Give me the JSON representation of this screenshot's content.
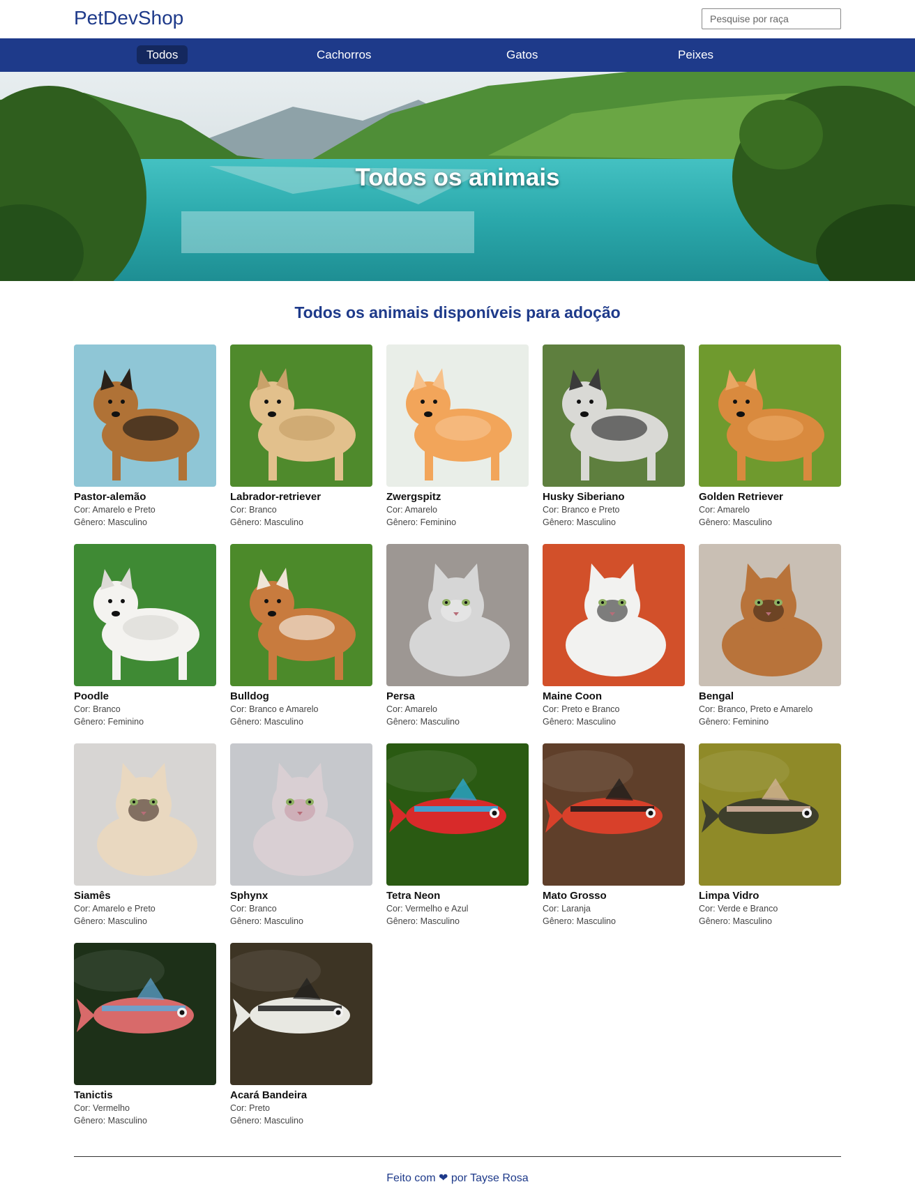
{
  "header": {
    "brand": "PetDevShop",
    "search_placeholder": "Pesquise por raça"
  },
  "nav": {
    "tabs": [
      {
        "label": "Todos",
        "active": true
      },
      {
        "label": "Cachorros",
        "active": false
      },
      {
        "label": "Gatos",
        "active": false
      },
      {
        "label": "Peixes",
        "active": false
      }
    ]
  },
  "hero": {
    "title": "Todos os animais"
  },
  "section": {
    "title": "Todos os animais disponíveis para adoção",
    "color_label": "Cor:",
    "gender_label": "Gênero:"
  },
  "animals": [
    {
      "name": "Pastor-alemão",
      "color": "Amarelo e Preto",
      "gender": "Masculino",
      "kind": "dog",
      "bg": "#8fc6d6",
      "body": "#b07236",
      "accent": "#2a2119"
    },
    {
      "name": "Labrador-retriever",
      "color": "Branco",
      "gender": "Masculino",
      "kind": "dog",
      "bg": "#4f8a2c",
      "body": "#e2c08c",
      "accent": "#c9a26a"
    },
    {
      "name": "Zwergspitz",
      "color": "Amarelo",
      "gender": "Feminino",
      "kind": "dog",
      "bg": "#e9eee8",
      "body": "#f2a55a",
      "accent": "#f7c18a"
    },
    {
      "name": "Husky Siberiano",
      "color": "Branco e Preto",
      "gender": "Masculino",
      "kind": "dog",
      "bg": "#5e7f3e",
      "body": "#d9d9d5",
      "accent": "#3b3b3b"
    },
    {
      "name": "Golden Retriever",
      "color": "Amarelo",
      "gender": "Masculino",
      "kind": "dog",
      "bg": "#6f9a2e",
      "body": "#d98a3e",
      "accent": "#e9a763"
    },
    {
      "name": "Poodle",
      "color": "Branco",
      "gender": "Feminino",
      "kind": "dog",
      "bg": "#3f8a34",
      "body": "#f4f3f0",
      "accent": "#dcdad6"
    },
    {
      "name": "Bulldog",
      "color": "Branco e Amarelo",
      "gender": "Masculino",
      "kind": "dog",
      "bg": "#4c8a2a",
      "body": "#c87b3e",
      "accent": "#efe4d6"
    },
    {
      "name": "Persa",
      "color": "Amarelo",
      "gender": "Masculino",
      "kind": "cat",
      "bg": "#9d9793",
      "body": "#d6d6d6",
      "accent": "#ededed"
    },
    {
      "name": "Maine Coon",
      "color": "Preto e Branco",
      "gender": "Masculino",
      "kind": "cat",
      "bg": "#d2502a",
      "body": "#f2f2f0",
      "accent": "#2e2e2e"
    },
    {
      "name": "Bengal",
      "color": "Branco, Preto e Amarelo",
      "gender": "Feminino",
      "kind": "cat",
      "bg": "#c9bfb4",
      "body": "#b8733a",
      "accent": "#3a2516"
    },
    {
      "name": "Siamês",
      "color": "Amarelo e Preto",
      "gender": "Masculino",
      "kind": "cat",
      "bg": "#d7d5d3",
      "body": "#e9d8c0",
      "accent": "#3e2a22"
    },
    {
      "name": "Sphynx",
      "color": "Branco",
      "gender": "Masculino",
      "kind": "cat",
      "bg": "#c6c8cc",
      "body": "#d9cfd3",
      "accent": "#c79aa6"
    },
    {
      "name": "Tetra Neon",
      "color": "Vermelho e Azul",
      "gender": "Masculino",
      "kind": "fish",
      "bg": "#2a5a12",
      "body": "#d82a2a",
      "accent": "#2ab0e8"
    },
    {
      "name": "Mato Grosso",
      "color": "Laranja",
      "gender": "Masculino",
      "kind": "fish",
      "bg": "#5f3f2a",
      "body": "#d8402a",
      "accent": "#1a1a1a"
    },
    {
      "name": "Limpa Vidro",
      "color": "Verde e Branco",
      "gender": "Masculino",
      "kind": "fish",
      "bg": "#8f8a28",
      "body": "#3e3f2c",
      "accent": "#d9b6a2"
    },
    {
      "name": "Tanictis",
      "color": "Vermelho",
      "gender": "Masculino",
      "kind": "fish",
      "bg": "#1d3018",
      "body": "#d86a6a",
      "accent": "#5fa8d8"
    },
    {
      "name": "Acará Bandeira",
      "color": "Preto",
      "gender": "Masculino",
      "kind": "fish",
      "bg": "#3d3424",
      "body": "#e8e8e2",
      "accent": "#1e1e1e"
    }
  ],
  "footer": {
    "text": "Feito com ❤ por Tayse Rosa"
  }
}
